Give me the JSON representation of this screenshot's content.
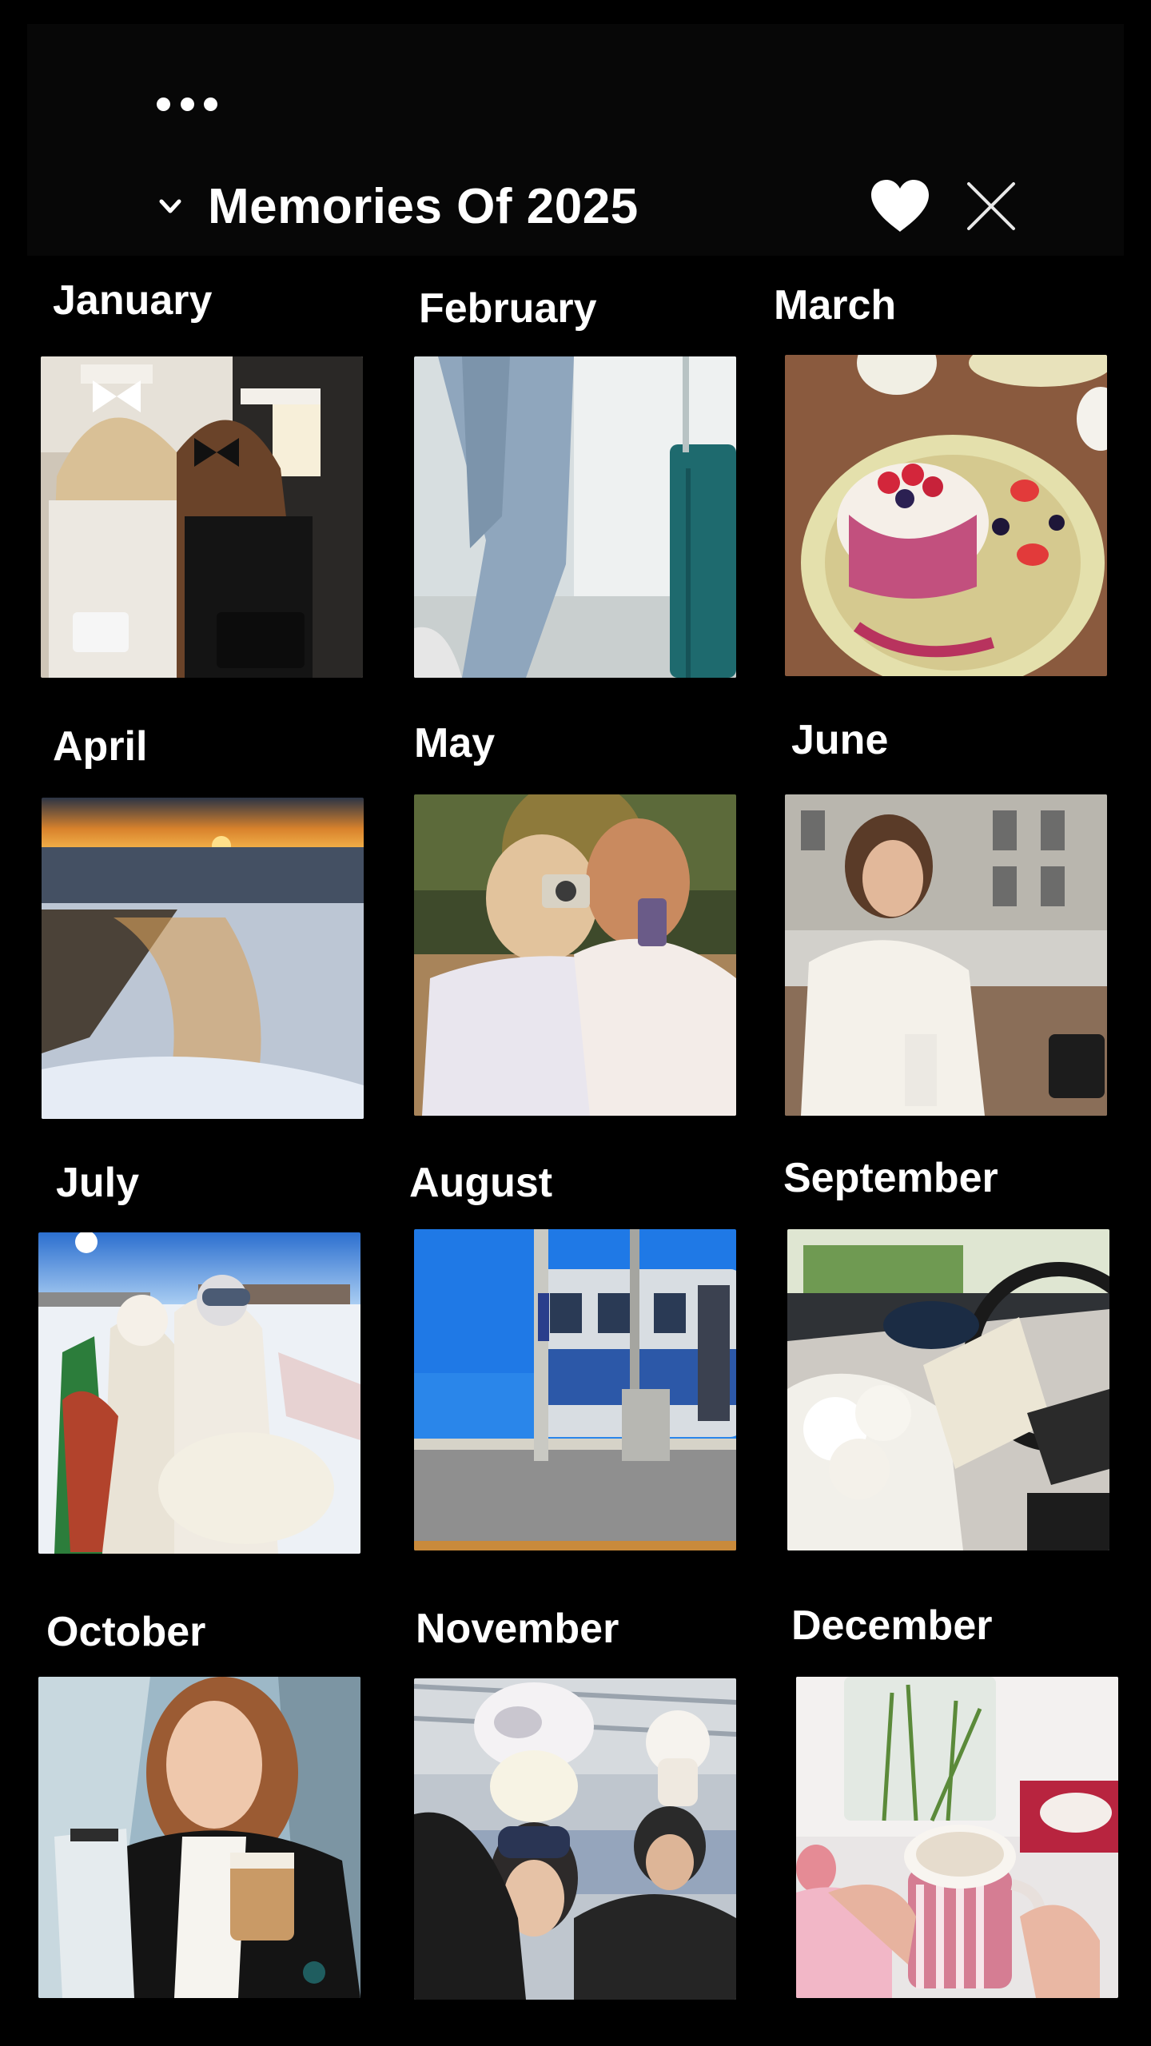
{
  "header": {
    "title": "Memories Of 2025",
    "icons": {
      "more": "more-dots-icon",
      "collapse": "chevron-down-icon",
      "like": "heart-icon",
      "close": "close-icon"
    }
  },
  "months": [
    {
      "label": "January",
      "photo": "two-women-chanel-bows"
    },
    {
      "label": "February",
      "photo": "jeans-suitcase-airport"
    },
    {
      "label": "March",
      "photo": "souffle-pancake-berries"
    },
    {
      "label": "April",
      "photo": "sunset-snowy-beach"
    },
    {
      "label": "May",
      "photo": "friends-film-camera"
    },
    {
      "label": "June",
      "photo": "woman-white-blazer-drink"
    },
    {
      "label": "July",
      "photo": "ski-friends-selfie"
    },
    {
      "label": "August",
      "photo": "blue-train-seaside"
    },
    {
      "label": "September",
      "photo": "flower-bouquet-car"
    },
    {
      "label": "October",
      "photo": "woman-coffee-clipboard"
    },
    {
      "label": "November",
      "photo": "friends-plush-hats"
    },
    {
      "label": "December",
      "photo": "latte-mug-flowers"
    }
  ],
  "colors": {
    "background": "#000000",
    "header_background": "#070707",
    "text": "#ffffff"
  }
}
